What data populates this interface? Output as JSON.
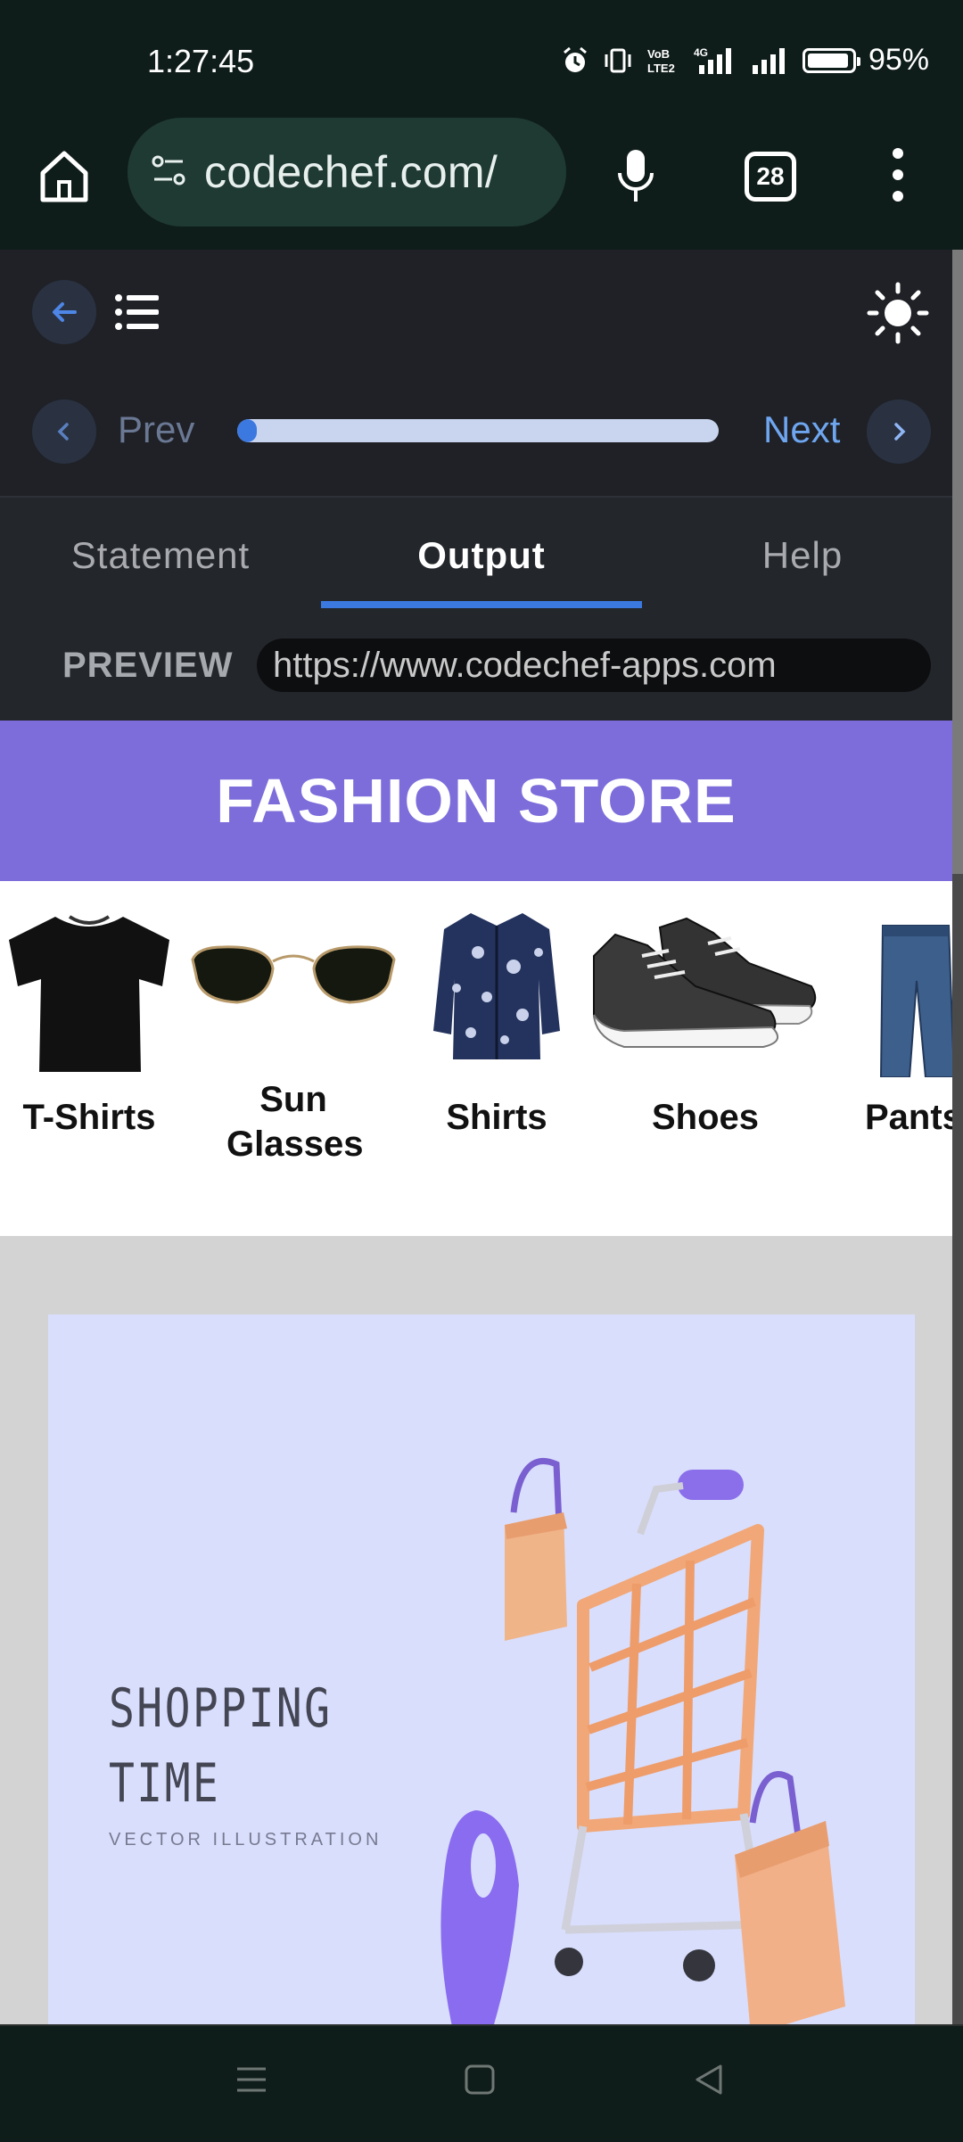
{
  "status_bar": {
    "time": "1:27:45",
    "network": "4G",
    "volte": "VoB LTE2",
    "battery_percent": "95%",
    "battery_level": 0.95
  },
  "browser": {
    "url": "codechef.com/",
    "tab_count": "28"
  },
  "toolbar": {
    "prev_label": "Prev",
    "next_label": "Next",
    "progress": 0.04
  },
  "tabs": [
    {
      "label": "Statement",
      "active": false
    },
    {
      "label": "Output",
      "active": true
    },
    {
      "label": "Help",
      "active": false
    }
  ],
  "preview": {
    "label": "PREVIEW",
    "url": "https://www.codechef-apps.com"
  },
  "store": {
    "title": "FASHION STORE",
    "categories": [
      {
        "label": "T-Shirts",
        "icon": "tshirt-icon"
      },
      {
        "label": "Sun Glasses",
        "icon": "sunglasses-icon"
      },
      {
        "label": "Shirts",
        "icon": "shirt-icon"
      },
      {
        "label": "Shoes",
        "icon": "shoes-icon"
      },
      {
        "label": "Pants",
        "icon": "pants-icon"
      }
    ],
    "banner": {
      "title_line1": "SHOPPING",
      "title_line2": "TIME",
      "subtitle": "VECTOR ILLUSTRATION"
    }
  },
  "colors": {
    "accent": "#3b78e0",
    "store_header": "#7d6ddb",
    "banner_bg": "#d9defc"
  }
}
